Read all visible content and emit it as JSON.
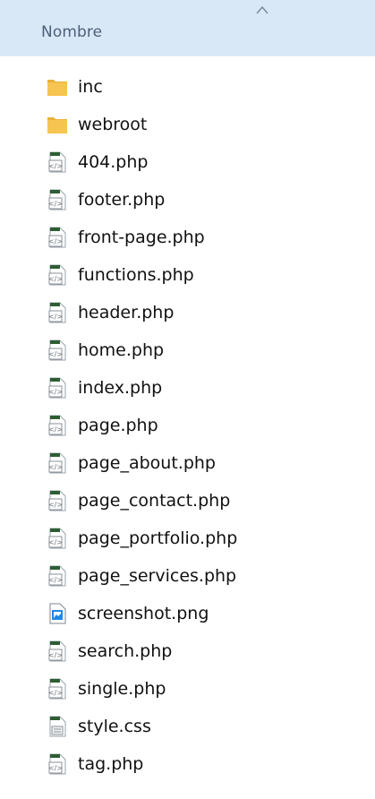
{
  "header": {
    "column_label": "Nombre",
    "sort_icon": "chevron-up-icon"
  },
  "files": [
    {
      "name": "inc",
      "icon": "folder"
    },
    {
      "name": "webroot",
      "icon": "folder"
    },
    {
      "name": "404.php",
      "icon": "php"
    },
    {
      "name": "footer.php",
      "icon": "php"
    },
    {
      "name": "front-page.php",
      "icon": "php"
    },
    {
      "name": "functions.php",
      "icon": "php"
    },
    {
      "name": "header.php",
      "icon": "php"
    },
    {
      "name": "home.php",
      "icon": "php"
    },
    {
      "name": "index.php",
      "icon": "php"
    },
    {
      "name": "page.php",
      "icon": "php"
    },
    {
      "name": "page_about.php",
      "icon": "php"
    },
    {
      "name": "page_contact.php",
      "icon": "php"
    },
    {
      "name": "page_portfolio.php",
      "icon": "php"
    },
    {
      "name": "page_services.php",
      "icon": "php"
    },
    {
      "name": "screenshot.png",
      "icon": "image"
    },
    {
      "name": "search.php",
      "icon": "php"
    },
    {
      "name": "single.php",
      "icon": "php"
    },
    {
      "name": "style.css",
      "icon": "css"
    },
    {
      "name": "tag.php",
      "icon": "php"
    }
  ],
  "colors": {
    "header_bg": "#d9e8f6",
    "header_text": "#4c607a",
    "folder": "#f6c451",
    "php_badge": "#2e7d32"
  }
}
